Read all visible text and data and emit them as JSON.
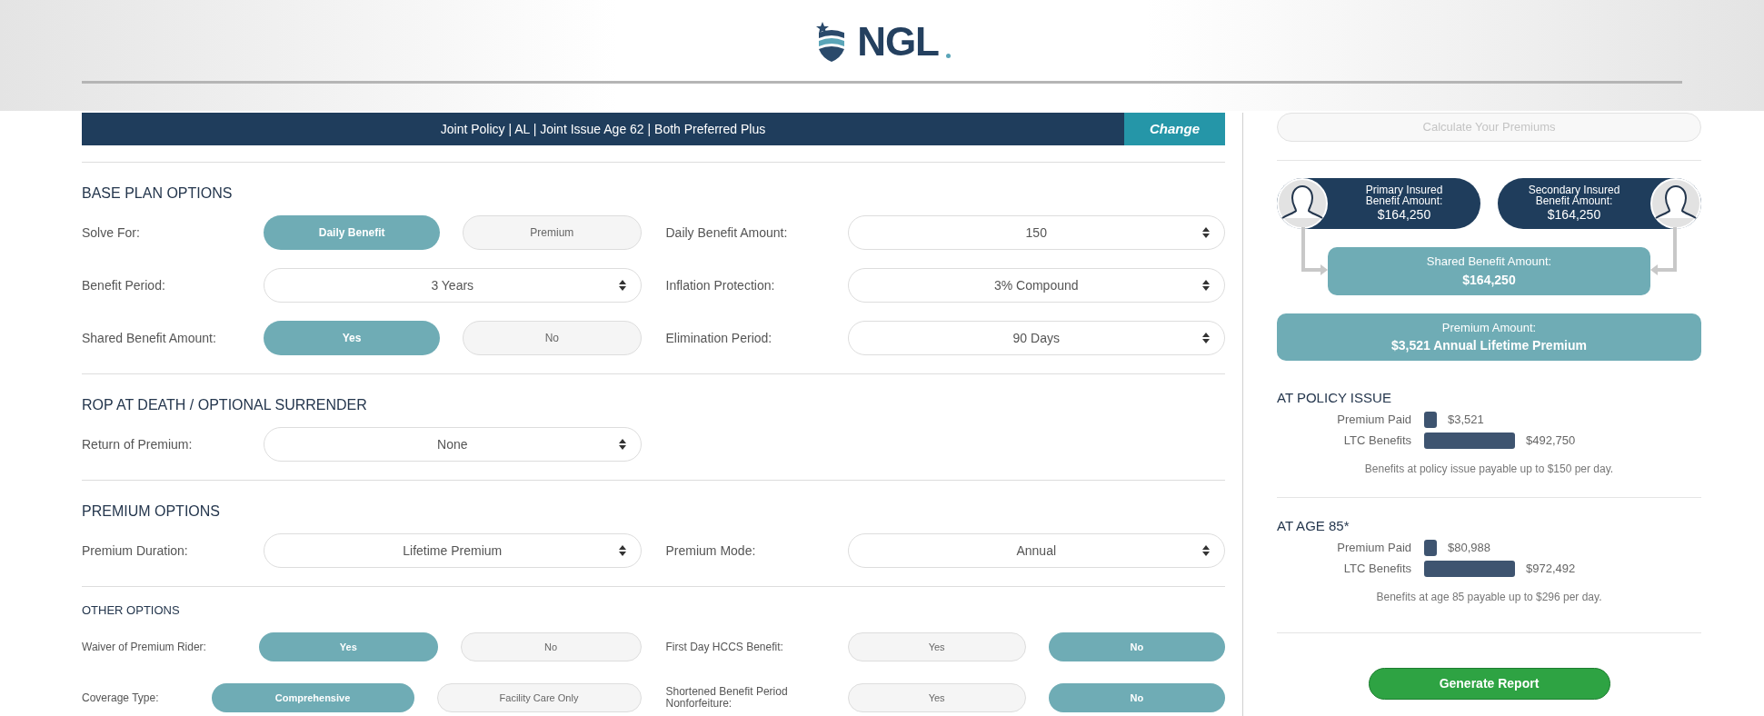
{
  "logo": {
    "text": "NGL"
  },
  "policy_bar": {
    "summary": "Joint Policy | AL | Joint Issue Age 62 | Both Preferred Plus",
    "action": "Change"
  },
  "sections": [
    {
      "title": "BASE PLAN OPTIONS",
      "compact": false,
      "rows": [
        {
          "fields": [
            {
              "kind": "toggle",
              "label": "Solve For:",
              "options": [
                {
                  "label": "Daily Benefit",
                  "selected": true
                },
                {
                  "label": "Premium",
                  "selected": false
                }
              ]
            },
            {
              "kind": "select",
              "label": "Daily Benefit Amount:",
              "value": "150"
            }
          ]
        },
        {
          "fields": [
            {
              "kind": "select",
              "label": "Benefit Period:",
              "value": "3 Years"
            },
            {
              "kind": "select",
              "label": "Inflation Protection:",
              "value": "3% Compound"
            }
          ]
        },
        {
          "fields": [
            {
              "kind": "toggle",
              "label": "Shared Benefit Amount:",
              "options": [
                {
                  "label": "Yes",
                  "selected": true
                },
                {
                  "label": "No",
                  "selected": false
                }
              ]
            },
            {
              "kind": "select",
              "label": "Elimination Period:",
              "value": "90 Days"
            }
          ]
        }
      ]
    },
    {
      "title": "ROP AT DEATH / OPTIONAL SURRENDER",
      "compact": false,
      "rows": [
        {
          "fields": [
            {
              "kind": "select",
              "label": "Return of Premium:",
              "value": "None"
            }
          ]
        }
      ]
    },
    {
      "title": "PREMIUM OPTIONS",
      "compact": false,
      "rows": [
        {
          "fields": [
            {
              "kind": "select",
              "label": "Premium Duration:",
              "value": "Lifetime Premium"
            },
            {
              "kind": "select",
              "label": "Premium Mode:",
              "value": "Annual"
            }
          ]
        }
      ]
    },
    {
      "title": "OTHER OPTIONS",
      "compact": true,
      "rows": [
        {
          "fields": [
            {
              "kind": "toggle",
              "label": "Waiver of Premium Rider:",
              "options": [
                {
                  "label": "Yes",
                  "selected": true
                },
                {
                  "label": "No",
                  "selected": false
                }
              ]
            },
            {
              "kind": "toggle",
              "label": "First Day HCCS Benefit:",
              "options": [
                {
                  "label": "Yes",
                  "selected": false
                },
                {
                  "label": "No",
                  "selected": true
                }
              ]
            }
          ]
        },
        {
          "fields": [
            {
              "kind": "toggle",
              "label": "Coverage Type:",
              "options": [
                {
                  "label": "Comprehensive",
                  "selected": true
                },
                {
                  "label": "Facility Care Only",
                  "selected": false
                }
              ]
            },
            {
              "kind": "toggle",
              "label": "Shortened Benefit Period Nonforfeiture:",
              "options": [
                {
                  "label": "Yes",
                  "selected": false
                },
                {
                  "label": "No",
                  "selected": true
                }
              ]
            }
          ]
        }
      ]
    }
  ],
  "summary": {
    "calculate_button": {
      "label": "Calculate Your Premiums",
      "disabled": true
    },
    "insured": [
      {
        "label": "Primary Insured Benefit Amount:",
        "amount": "$164,250"
      },
      {
        "label": "Secondary Insured Benefit Amount:",
        "amount": "$164,250"
      }
    ],
    "shared": {
      "label": "Shared Benefit Amount:",
      "amount": "$164,250"
    },
    "premium": {
      "label": "Premium Amount:",
      "amount": "$3,521 Annual Lifetime Premium"
    },
    "comparisons": [
      {
        "title": "AT POLICY ISSUE",
        "bars": [
          {
            "label": "Premium Paid",
            "value": "$3,521",
            "kind": "premium"
          },
          {
            "label": "LTC Benefits",
            "value": "$492,750",
            "kind": "benefits"
          }
        ],
        "note": "Benefits at policy issue payable up to $150 per day."
      },
      {
        "title": "AT AGE 85*",
        "bars": [
          {
            "label": "Premium Paid",
            "value": "$80,988",
            "kind": "premium"
          },
          {
            "label": "LTC Benefits",
            "value": "$972,492",
            "kind": "benefits"
          }
        ],
        "note": "Benefits at age 85 payable up to $296 per day."
      }
    ],
    "report_button": "Generate Report"
  }
}
